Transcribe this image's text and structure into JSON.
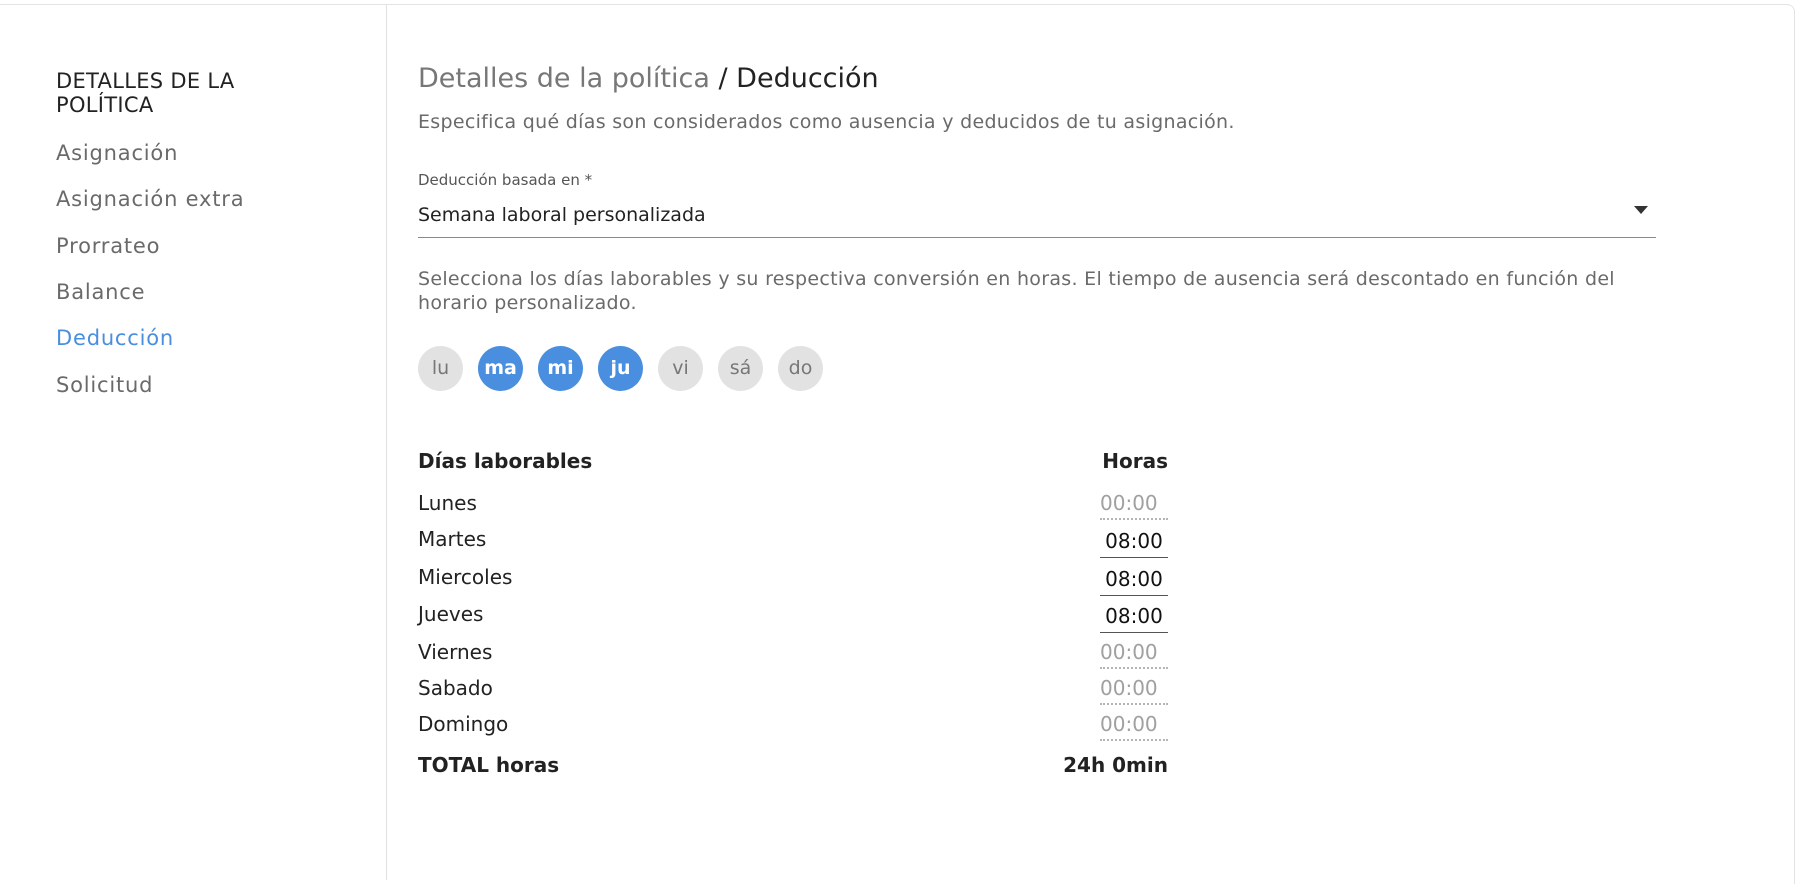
{
  "sidebar": {
    "title": "DETALLES DE LA POLÍTICA",
    "items": [
      {
        "label": "Asignación"
      },
      {
        "label": "Asignación extra"
      },
      {
        "label": "Prorrateo"
      },
      {
        "label": "Balance"
      },
      {
        "label": "Deducción",
        "active": true
      },
      {
        "label": "Solicitud"
      }
    ],
    "active_color": "#4a8ee0"
  },
  "header": {
    "breadcrumb": "Detalles de la política",
    "separator": " / ",
    "current": "Deducción",
    "description": "Especifica qué días son considerados como ausencia y deducidos de tu asignación."
  },
  "deduction": {
    "label": "Deducción basada en *",
    "value": "Semana laboral personalizada",
    "helper": "Selecciona los días laborables y su respectiva conversión en horas. El tiempo de ausencia será descontado en función del horario personalizado."
  },
  "day_toggles": [
    {
      "label": "lu",
      "selected": false
    },
    {
      "label": "ma",
      "selected": true
    },
    {
      "label": "mi",
      "selected": true
    },
    {
      "label": "ju",
      "selected": true
    },
    {
      "label": "vi",
      "selected": false
    },
    {
      "label": "sá",
      "selected": false
    },
    {
      "label": "do",
      "selected": false
    }
  ],
  "table": {
    "header_days": "Días laborables",
    "header_hours": "Horas",
    "rows": [
      {
        "day": "Lunes",
        "hours": "00:00",
        "enabled": false
      },
      {
        "day": "Martes",
        "hours": "08:00",
        "enabled": true
      },
      {
        "day": "Miercoles",
        "hours": "08:00",
        "enabled": true
      },
      {
        "day": "Jueves",
        "hours": "08:00",
        "enabled": true
      },
      {
        "day": "Viernes",
        "hours": "00:00",
        "enabled": false
      },
      {
        "day": "Sabado",
        "hours": "00:00",
        "enabled": false
      },
      {
        "day": "Domingo",
        "hours": "00:00",
        "enabled": false
      }
    ],
    "total_label": "TOTAL horas",
    "total_value": "24h 0min"
  }
}
